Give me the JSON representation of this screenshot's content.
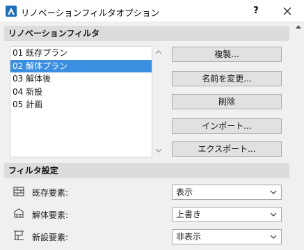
{
  "window": {
    "title": "リノベーションフィルタオプション",
    "help_label": "?"
  },
  "filters_section": {
    "header": "リノベーションフィルタ",
    "items": [
      {
        "label": "01 既存プラン",
        "selected": false
      },
      {
        "label": "02 解体プラン",
        "selected": true
      },
      {
        "label": "03 解体後",
        "selected": false
      },
      {
        "label": "04 新設",
        "selected": false
      },
      {
        "label": "05 計画",
        "selected": false
      }
    ],
    "buttons": {
      "duplicate": "複製...",
      "rename": "名前を変更...",
      "delete": "削除",
      "import": "インポート...",
      "export": "エクスポート..."
    }
  },
  "settings_section": {
    "header": "フィルタ設定",
    "rows": [
      {
        "label": "既存要素:",
        "value": "表示",
        "icon": "existing-element-icon"
      },
      {
        "label": "解体要素:",
        "value": "上書き",
        "icon": "demolished-element-icon"
      },
      {
        "label": "新設要素:",
        "value": "非表示",
        "icon": "new-element-icon"
      }
    ]
  },
  "colors": {
    "selection": "#3a8fe0",
    "section_header": "#dcdcdc",
    "button": "#e1e1e1"
  }
}
